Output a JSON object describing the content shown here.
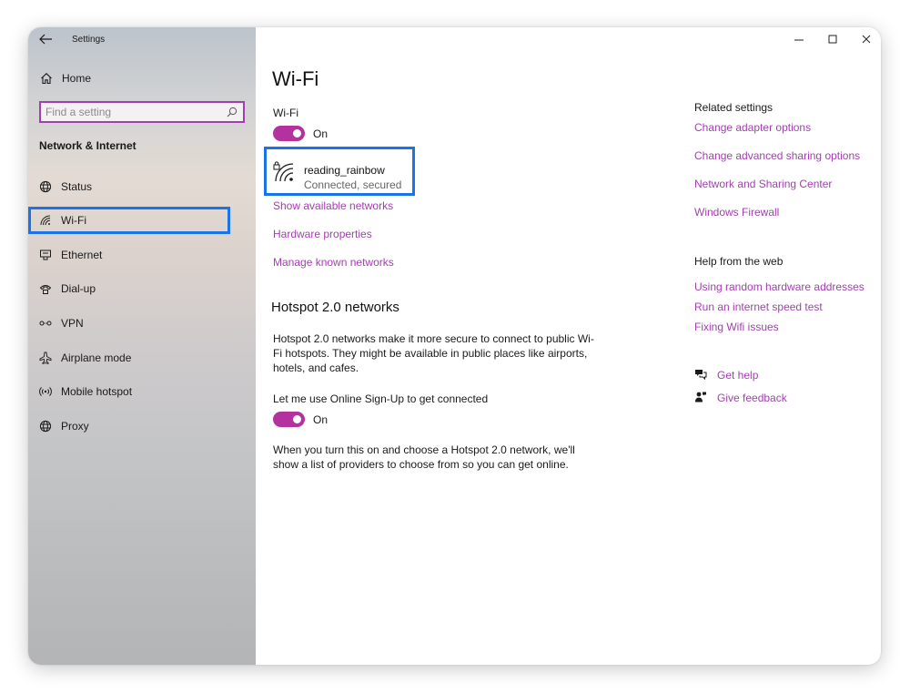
{
  "window": {
    "app_title": "Settings"
  },
  "sidebar": {
    "home_label": "Home",
    "search_placeholder": "Find a setting",
    "section_title": "Network & Internet",
    "items": [
      {
        "label": "Status",
        "icon": "globe-icon"
      },
      {
        "label": "Wi-Fi",
        "icon": "wifi-icon",
        "selected": true
      },
      {
        "label": "Ethernet",
        "icon": "ethernet-icon"
      },
      {
        "label": "Dial-up",
        "icon": "dialup-icon"
      },
      {
        "label": "VPN",
        "icon": "vpn-icon"
      },
      {
        "label": "Airplane mode",
        "icon": "airplane-icon"
      },
      {
        "label": "Mobile hotspot",
        "icon": "hotspot-icon"
      },
      {
        "label": "Proxy",
        "icon": "globe-icon"
      }
    ]
  },
  "main": {
    "title": "Wi-Fi",
    "wifi_label": "Wi-Fi",
    "wifi_toggle_state": "On",
    "network": {
      "name": "reading_rainbow",
      "status": "Connected, secured"
    },
    "links": {
      "show_networks": "Show available networks",
      "hardware_properties": "Hardware properties",
      "manage_known": "Manage known networks"
    },
    "hotspot": {
      "heading": "Hotspot 2.0 networks",
      "desc_lines": [
        "Hotspot 2.0 networks make it more secure to connect to public Wi-",
        "Fi hotspots. They might be available in public places like airports,",
        "hotels, and cafes."
      ],
      "signup_label": "Let me use Online Sign-Up to get connected",
      "signup_toggle_state": "On",
      "note_lines": [
        "When you turn this on and choose a Hotspot 2.0 network, we'll",
        "show a list of providers to choose from so you can get online."
      ]
    }
  },
  "related": {
    "heading": "Related settings",
    "links": [
      "Change adapter options",
      "Change advanced sharing options",
      "Network and Sharing Center",
      "Windows Firewall"
    ]
  },
  "help_web": {
    "heading": "Help from the web",
    "links": [
      "Using random hardware addresses",
      "Run an internet speed test",
      "Fixing Wifi issues"
    ]
  },
  "support": {
    "get_help": "Get help",
    "give_feedback": "Give feedback"
  },
  "colors": {
    "accent": "#b4329f",
    "link": "#a23fb0",
    "highlight": "#1a73e8"
  }
}
